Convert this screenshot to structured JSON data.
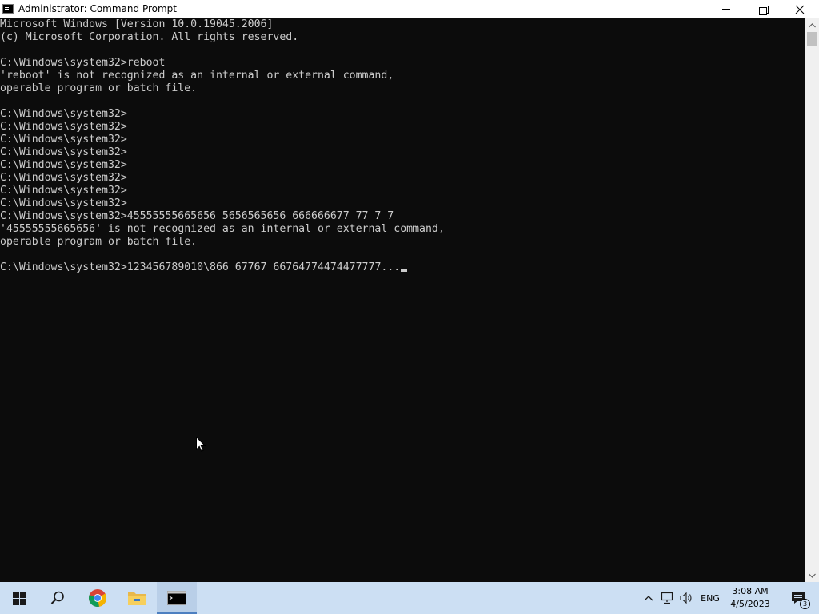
{
  "window": {
    "title": "Administrator: Command Prompt",
    "icon": "cmd-icon"
  },
  "console": {
    "lines": [
      "Microsoft Windows [Version 10.0.19045.2006]",
      "(c) Microsoft Corporation. All rights reserved.",
      "",
      "C:\\Windows\\system32>reboot",
      "'reboot' is not recognized as an internal or external command,",
      "operable program or batch file.",
      "",
      "C:\\Windows\\system32>",
      "C:\\Windows\\system32>",
      "C:\\Windows\\system32>",
      "C:\\Windows\\system32>",
      "C:\\Windows\\system32>",
      "C:\\Windows\\system32>",
      "C:\\Windows\\system32>",
      "C:\\Windows\\system32>",
      "C:\\Windows\\system32>45555555665656 5656565656 666666677 77 7 7",
      "'45555555665656' is not recognized as an internal or external command,",
      "operable program or batch file.",
      ""
    ],
    "current_prompt": "C:\\Windows\\system32>",
    "current_input": "123456789010\\866 67767 66764774474477777...",
    "text_color": "#cccccc",
    "background": "#0c0c0c"
  },
  "taskbar": {
    "background": "#ccdff3",
    "apps": [
      {
        "name": "start",
        "icon": "windows-logo-icon"
      },
      {
        "name": "search",
        "icon": "search-icon"
      },
      {
        "name": "chrome",
        "icon": "chrome-icon"
      },
      {
        "name": "file-explorer",
        "icon": "folder-icon"
      },
      {
        "name": "command-prompt",
        "icon": "cmd-icon",
        "active": true
      }
    ],
    "tray": {
      "language": "ENG",
      "time": "3:08 AM",
      "date": "4/5/2023",
      "notification_count": "3"
    }
  }
}
